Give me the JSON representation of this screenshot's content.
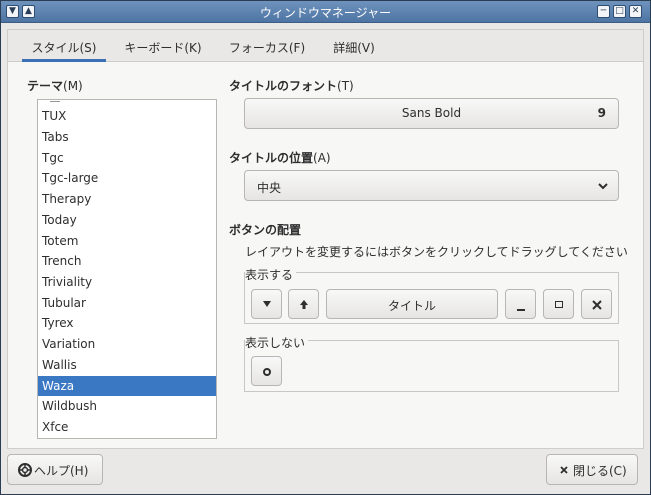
{
  "window": {
    "title": "ウィンドウマネージャー"
  },
  "tabs": [
    {
      "label": "スタイル(S)",
      "active": true
    },
    {
      "label": "キーボード(K)",
      "active": false
    },
    {
      "label": "フォーカス(F)",
      "active": false
    },
    {
      "label": "詳細(V)",
      "active": false
    }
  ],
  "theme": {
    "label": "テーマ",
    "mnemonic": "(M)",
    "items": [
      "TUX",
      "Tabs",
      "Tgc",
      "Tgc-large",
      "Therapy",
      "Today",
      "Totem",
      "Trench",
      "Triviality",
      "Tubular",
      "Tyrex",
      "Variation",
      "Wallis",
      "Waza",
      "Wildbush",
      "Xfce"
    ],
    "selected": "Waza"
  },
  "title_font": {
    "label": "タイトルのフォント",
    "mnemonic": "(T)",
    "font_name": "Sans Bold",
    "font_size": "9"
  },
  "title_align": {
    "label": "タイトルの位置",
    "mnemonic": "(A)",
    "value": "中央"
  },
  "button_layout": {
    "label": "ボタンの配置",
    "hint": "レイアウトを変更するにはボタンをクリックしてドラッグしてください",
    "active_label": "表示する",
    "hidden_label": "表示しない",
    "title_button": "タイトル"
  },
  "footer": {
    "help": "ヘルプ(H)",
    "close": "閉じる(C)"
  },
  "colors": {
    "accent": "#3b78c3",
    "titlebar": "#5a80ae"
  }
}
